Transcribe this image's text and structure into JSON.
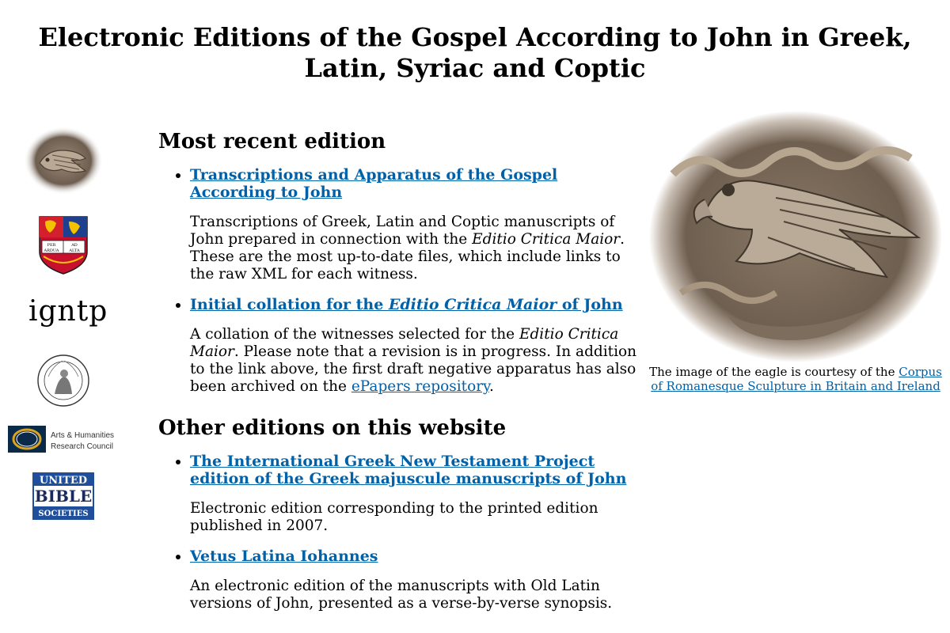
{
  "page": {
    "title": "Electronic Editions of the Gospel According to John in Greek, Latin, Syriac and Coptic"
  },
  "logos": {
    "igntp_text": "igntp",
    "crest_motto": [
      "PER",
      "ARDUA",
      "AD",
      "ALTA"
    ],
    "ahrc_line1": "Arts & Humanities",
    "ahrc_line2": "Research Council",
    "ubs_line1": "UNITED",
    "ubs_line2": "BIBLE",
    "ubs_line3": "SOCIETIES"
  },
  "recent": {
    "heading": "Most recent edition",
    "item1": {
      "link": "Transcriptions and Apparatus of the Gospel According to John",
      "desc_a": "Transcriptions of Greek, Latin and Coptic manuscripts of John prepared in connection with the ",
      "desc_em": "Editio Critica Maior",
      "desc_b": ". These are the most up-to-date files, which include links to the raw XML for each witness."
    },
    "item2": {
      "link_a": "Initial collation for the ",
      "link_em": "Editio Critica Maior",
      "link_b": " of John",
      "desc_a": "A collation of the witnesses selected for the ",
      "desc_em": "Editio Critica Maior",
      "desc_b": ". Please note that a revision is in progress. In addition to the link above, the first draft negative apparatus has also been archived on the ",
      "desc_link": "ePapers repository",
      "desc_c": "."
    }
  },
  "other": {
    "heading": "Other editions on this website",
    "item1": {
      "link": "The International Greek New Testament Project edition of the Greek majuscule manuscripts of John",
      "desc": "Electronic edition corresponding to the printed edition published in 2007."
    },
    "item2": {
      "link": "Vetus Latina Iohannes",
      "desc": "An electronic edition of the manuscripts with Old Latin versions of John, presented as a verse-by-verse synopsis."
    }
  },
  "caption": {
    "text": "The image of the eagle is courtesy of the ",
    "link": "Corpus of Romanesque Sculpture in Britain and Ireland"
  }
}
